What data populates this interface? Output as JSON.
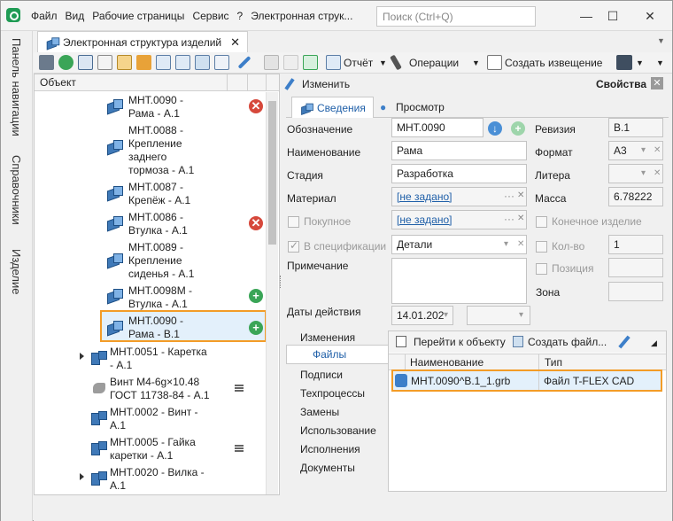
{
  "menu": [
    "Файл",
    "Вид",
    "Рабочие страницы",
    "Сервис",
    "?",
    "Электронная струк..."
  ],
  "search": {
    "placeholder": "Поиск (Ctrl+Q)"
  },
  "window_controls": {
    "minimize": "—",
    "maximize": "☐",
    "close": "✕"
  },
  "sidebar_tabs": [
    "Панель навигации",
    "Справочники",
    "Изделие"
  ],
  "doc_tab": {
    "title": "Электронная структура изделий",
    "close": "✕"
  },
  "toolbar": {
    "report": "Отчёт",
    "operations": "Операции",
    "create_notice": "Создать извещение"
  },
  "tree": {
    "header": "Объект",
    "nodes": [
      {
        "lines": [
          "МНТ.0090 -",
          "Рама - А.1"
        ],
        "badge": "✕"
      },
      {
        "lines": [
          "МНТ.0088 -",
          "Крепление",
          "заднего",
          "тормоза - А.1"
        ]
      },
      {
        "lines": [
          "МНТ.0087 -",
          "Крепёж - А.1"
        ]
      },
      {
        "lines": [
          "МНТ.0086 -",
          "Втулка - А.1"
        ],
        "badge": "✕"
      },
      {
        "lines": [
          "МНТ.0089 -",
          "Крепление",
          "сиденья - А.1"
        ]
      },
      {
        "lines": [
          "МНТ.0098М -",
          "Втулка - А.1"
        ],
        "badge": "+"
      },
      {
        "lines": [
          "МНТ.0090 -",
          "Рама - В.1"
        ],
        "badge": "+"
      },
      {
        "lines": [
          "МНТ.0051 - Каретка",
          "- А.1"
        ]
      },
      {
        "lines": [
          "Винт М4-6g×10.48",
          "ГОСТ 11738-84 - А.1"
        ]
      },
      {
        "lines": [
          "МНТ.0002 - Винт -",
          "А.1"
        ]
      },
      {
        "lines": [
          "МНТ.0005 - Гайка",
          "каретки - А.1"
        ]
      },
      {
        "lines": [
          "МНТ.0020 - Вилка -",
          "А.1"
        ]
      }
    ]
  },
  "props": {
    "edit": "Изменить",
    "panel_title": "Свойства",
    "close": "✕",
    "tabs": [
      "Сведения",
      "Просмотр"
    ],
    "fields": {
      "designation_label": "Обозначение",
      "designation": "МНТ.0090",
      "revision_label": "Ревизия",
      "revision": "В.1",
      "name_label": "Наименование",
      "name": "Рама",
      "format_label": "Формат",
      "format": "A3",
      "stage_label": "Стадия",
      "stage": "Разработка",
      "litera_label": "Литера",
      "material_label": "Материал",
      "material": "[не задано]",
      "mass_label": "Масса",
      "mass": "6.78222",
      "purchased_label": "Покупное",
      "purchased_value": "[не задано]",
      "final_label": "Конечное изделие",
      "in_spec_label": "В спецификации",
      "section": "Детали",
      "qty_label": "Кол-во",
      "qty": "1",
      "note_label": "Примечание",
      "position_label": "Позиция",
      "zone_label": "Зона",
      "dates_label": "Даты действия",
      "date_from": "14.01.202",
      "ellipsis": "···",
      "clear": "✕",
      "dropdown": "▾"
    },
    "subnav": [
      "Изменения",
      "Файлы",
      "Подписи",
      "Техпроцессы",
      "Замены",
      "Использование",
      "Исполнения",
      "Документы"
    ],
    "files": {
      "goto": "Перейти к объекту",
      "create": "Создать файл...",
      "col_name": "Наименование",
      "col_type": "Тип",
      "row_name": "МНТ.0090^В.1_1.grb",
      "row_type": "Файл T-FLEX CAD"
    }
  }
}
